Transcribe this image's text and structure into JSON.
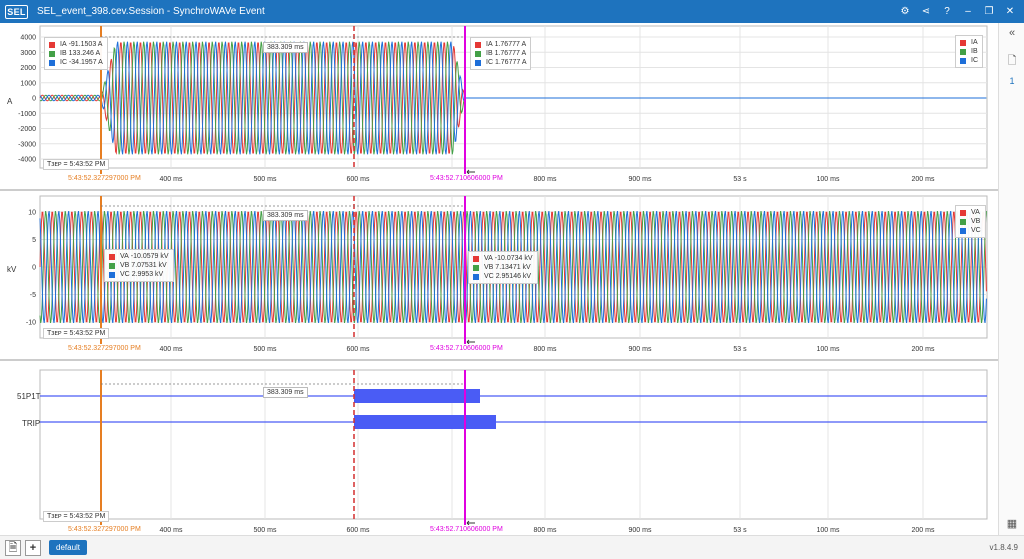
{
  "app": {
    "logo": "SEL",
    "title": "SEL_event_398.cev.Session - SynchroWAVe Event",
    "version": "v1.8.4.9"
  },
  "colors": {
    "phase_a": "#e53935",
    "phase_b": "#43a047",
    "phase_c": "#1e6fd9",
    "cursor1": "#e67e22",
    "cursor2": "#e000e0",
    "marker": "#d32f2f",
    "digital": "#4a5cf5"
  },
  "toolbar": {
    "icons": [
      "gear-icon",
      "share-icon",
      "help-icon",
      "minimize-icon",
      "restore-icon",
      "close-icon"
    ],
    "glyphs": [
      "⚙",
      "⋖",
      "?",
      "–",
      "❐",
      "✕"
    ]
  },
  "sidebar": {
    "collapse": "«",
    "page_glyph": "🗋",
    "page_number": "1",
    "calculator_glyph": "▦"
  },
  "footer": {
    "tab_label": "default",
    "export_glyph": "🗎",
    "add_glyph": "+"
  },
  "cursors": {
    "t1": "5:43:52.327297000 PM",
    "t2": "5:43:52.710606000 PM",
    "delta": "383.309 ms",
    "tref": "Tᴈᴇᴘ = 5:43:52 PM"
  },
  "x_ticks": [
    "400 ms",
    "500 ms",
    "600 ms",
    "700 ms",
    "800 ms",
    "900 ms",
    "53 s",
    "100 ms",
    "200 ms"
  ],
  "panels": {
    "current": {
      "ylabel": "A",
      "yticks": [
        "4000",
        "3000",
        "2000",
        "1000",
        "0",
        "-1000",
        "-2000",
        "-3000",
        "-4000"
      ],
      "legend": [
        "IA",
        "IB",
        "IC"
      ],
      "cursor1_values": [
        {
          "name": "IA",
          "value": "-91.1503 A"
        },
        {
          "name": "IB",
          "value": "133.246 A"
        },
        {
          "name": "IC",
          "value": "-34.1957 A"
        }
      ],
      "cursor2_values": [
        {
          "name": "IA",
          "value": "1.76777 A"
        },
        {
          "name": "IB",
          "value": "1.76777 A"
        },
        {
          "name": "IC",
          "value": "1.76777 A"
        }
      ]
    },
    "voltage": {
      "ylabel": "kV",
      "yticks": [
        "10",
        "5",
        "0",
        "-5",
        "-10"
      ],
      "legend": [
        "VA",
        "VB",
        "VC"
      ],
      "cursor1_values": [
        {
          "name": "VA",
          "value": "-10.0579 kV"
        },
        {
          "name": "VB",
          "value": "7.07531 kV"
        },
        {
          "name": "VC",
          "value": "2.9953 kV"
        }
      ],
      "cursor2_values": [
        {
          "name": "VA",
          "value": "-10.0734 kV"
        },
        {
          "name": "VB",
          "value": "7.13471 kV"
        },
        {
          "name": "VC",
          "value": "2.95146 kV"
        }
      ]
    },
    "digital": {
      "channels": [
        "51P1T",
        "TRIP"
      ]
    }
  }
}
